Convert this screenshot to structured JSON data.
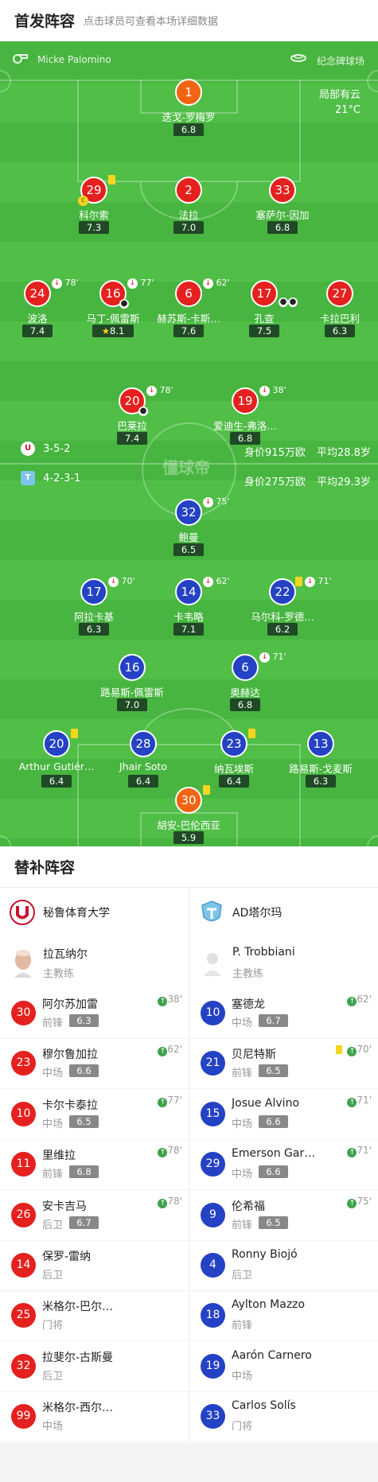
{
  "header": {
    "title": "首发阵容",
    "subtitle": "点击球员可查看本场详细数据"
  },
  "pitch_info": {
    "referee": "Micke Palomino",
    "stadium": "纪念碑球场",
    "weather": "局部有云",
    "temperature": "21°C",
    "watermark": "懂球帝"
  },
  "home": {
    "name": "秘鲁体育大学",
    "formation": "3-5-2",
    "value": "身价915万欧",
    "avg_age": "平均28.8岁",
    "color": "#e4211e"
  },
  "away": {
    "name": "AD塔尔玛",
    "formation": "4-2-3-1",
    "value": "身价275万欧",
    "avg_age": "平均29.3岁",
    "color": "#2442c4"
  },
  "home_starters": [
    {
      "num": "1",
      "name": "迭戈-罗梅罗",
      "rating": "6.8",
      "color": "orange"
    },
    {
      "num": "29",
      "name": "科尔索",
      "rating": "7.3",
      "color": "red",
      "captain": "c",
      "yellow": true
    },
    {
      "num": "2",
      "name": "法拉",
      "rating": "7.0",
      "color": "red"
    },
    {
      "num": "33",
      "name": "塞萨尔-因加",
      "rating": "6.8",
      "color": "red"
    },
    {
      "num": "24",
      "name": "波洛",
      "rating": "7.4",
      "color": "red",
      "sub": "78'"
    },
    {
      "num": "16",
      "name": "马丁-佩雷斯",
      "rating": "8.1",
      "color": "red",
      "sub": "77'",
      "goal": true,
      "star": true
    },
    {
      "num": "6",
      "name": "赫苏斯-卡斯…",
      "rating": "7.6",
      "color": "red",
      "sub": "62'"
    },
    {
      "num": "17",
      "name": "孔查",
      "rating": "7.5",
      "color": "red",
      "goal2": true
    },
    {
      "num": "27",
      "name": "卡拉巴利",
      "rating": "6.3",
      "color": "red"
    },
    {
      "num": "20",
      "name": "巴莱拉",
      "rating": "7.4",
      "color": "red",
      "sub": "78'",
      "goal": true
    },
    {
      "num": "19",
      "name": "爱迪生-弗洛…",
      "rating": "6.8",
      "color": "red",
      "sub": "38'"
    }
  ],
  "away_starters": [
    {
      "num": "32",
      "name": "鲍曼",
      "rating": "6.5",
      "sub": "75'"
    },
    {
      "num": "17",
      "name": "阿拉卡基",
      "rating": "6.3",
      "sub": "70'"
    },
    {
      "num": "14",
      "name": "卡韦略",
      "rating": "7.1",
      "sub": "62'"
    },
    {
      "num": "22",
      "name": "马尔科-罗德…",
      "rating": "6.2",
      "sub": "71'",
      "yellow": true
    },
    {
      "num": "16",
      "name": "路易斯-佩雷斯",
      "rating": "7.0"
    },
    {
      "num": "6",
      "name": "奥赫达",
      "rating": "6.8",
      "sub": "71'"
    },
    {
      "num": "20",
      "name": "Arthur Gutiér…",
      "rating": "6.4",
      "yellow": true
    },
    {
      "num": "28",
      "name": "Jhair Soto",
      "rating": "6.4"
    },
    {
      "num": "23",
      "name": "纳瓦埃斯",
      "rating": "6.4",
      "yellow": true
    },
    {
      "num": "13",
      "name": "路易斯-戈麦斯",
      "rating": "6.3"
    },
    {
      "num": "30",
      "name": "胡安-巴伦西亚",
      "rating": "5.9",
      "color": "orange",
      "yellow": true
    }
  ],
  "bench": {
    "title": "替补阵容",
    "home_coach": {
      "name": "拉瓦纳尔",
      "role": "主教练"
    },
    "away_coach": {
      "name": "P. Trobbiani",
      "role": "主教练"
    },
    "home": [
      {
        "num": "30",
        "name": "阿尔苏加雷",
        "pos": "前锋",
        "rating": "6.3",
        "in": "38'"
      },
      {
        "num": "23",
        "name": "穆尔鲁加拉",
        "pos": "中场",
        "rating": "6.6",
        "in": "62'"
      },
      {
        "num": "10",
        "name": "卡尔卡泰拉",
        "pos": "中场",
        "rating": "6.5",
        "in": "77'"
      },
      {
        "num": "11",
        "name": "里维拉",
        "pos": "前锋",
        "rating": "6.8",
        "in": "78'"
      },
      {
        "num": "26",
        "name": "安卡吉马",
        "pos": "后卫",
        "rating": "6.7",
        "in": "78'"
      },
      {
        "num": "14",
        "name": "保罗-雷纳",
        "pos": "后卫"
      },
      {
        "num": "25",
        "name": "米格尔-巴尔…",
        "pos": "门将"
      },
      {
        "num": "32",
        "name": "拉斐尔-古斯曼",
        "pos": "后卫"
      },
      {
        "num": "99",
        "name": "米格尔-西尔…",
        "pos": "中场"
      }
    ],
    "away": [
      {
        "num": "10",
        "name": "塞德龙",
        "pos": "中场",
        "rating": "6.7",
        "in": "62'"
      },
      {
        "num": "21",
        "name": "贝尼特斯",
        "pos": "前锋",
        "rating": "6.5",
        "in": "70'",
        "yellow": true
      },
      {
        "num": "15",
        "name": "Josue Alvino",
        "pos": "中场",
        "rating": "6.6",
        "in": "71'"
      },
      {
        "num": "29",
        "name": "Emerson Gar…",
        "pos": "中场",
        "rating": "6.6",
        "in": "71'"
      },
      {
        "num": "9",
        "name": "伦希福",
        "pos": "前锋",
        "rating": "6.5",
        "in": "75'"
      },
      {
        "num": "4",
        "name": "Ronny Biojó",
        "pos": "后卫"
      },
      {
        "num": "18",
        "name": "Aylton Mazzo",
        "pos": "前锋"
      },
      {
        "num": "19",
        "name": "Aarón Carnero",
        "pos": "中场"
      },
      {
        "num": "33",
        "name": "Carlos Solís",
        "pos": "门将"
      }
    ]
  },
  "icons": {
    "referee": "whistle-icon",
    "stadium": "stadium-icon",
    "sub": "sub-out-icon",
    "goal": "ball-icon",
    "captain": "captain-icon",
    "sub_in": "sub-in-icon"
  }
}
